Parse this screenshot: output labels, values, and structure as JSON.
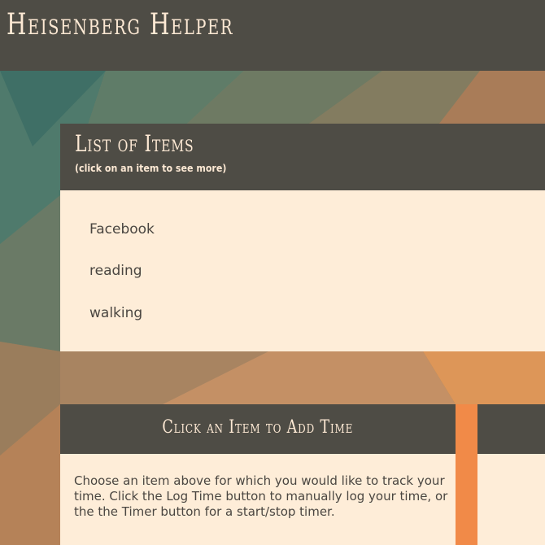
{
  "app": {
    "title": "Heisenberg Helper"
  },
  "items_panel": {
    "heading": "List of Items",
    "subheading": "(click on an item to see more)",
    "items": [
      "Facebook",
      "reading",
      "walking"
    ]
  },
  "add_time_panel": {
    "heading": "Click an Item to Add Time",
    "text": "Choose an item above for which you would like to track your time. Click the Log Time button to manually log your time, or the the Timer button for a start/stop timer."
  },
  "colors": {
    "header_bg": "#4e4c45",
    "panel_body_bg": "#feedd8",
    "heading_text": "#fde9d4",
    "body_text": "#4a4641"
  }
}
